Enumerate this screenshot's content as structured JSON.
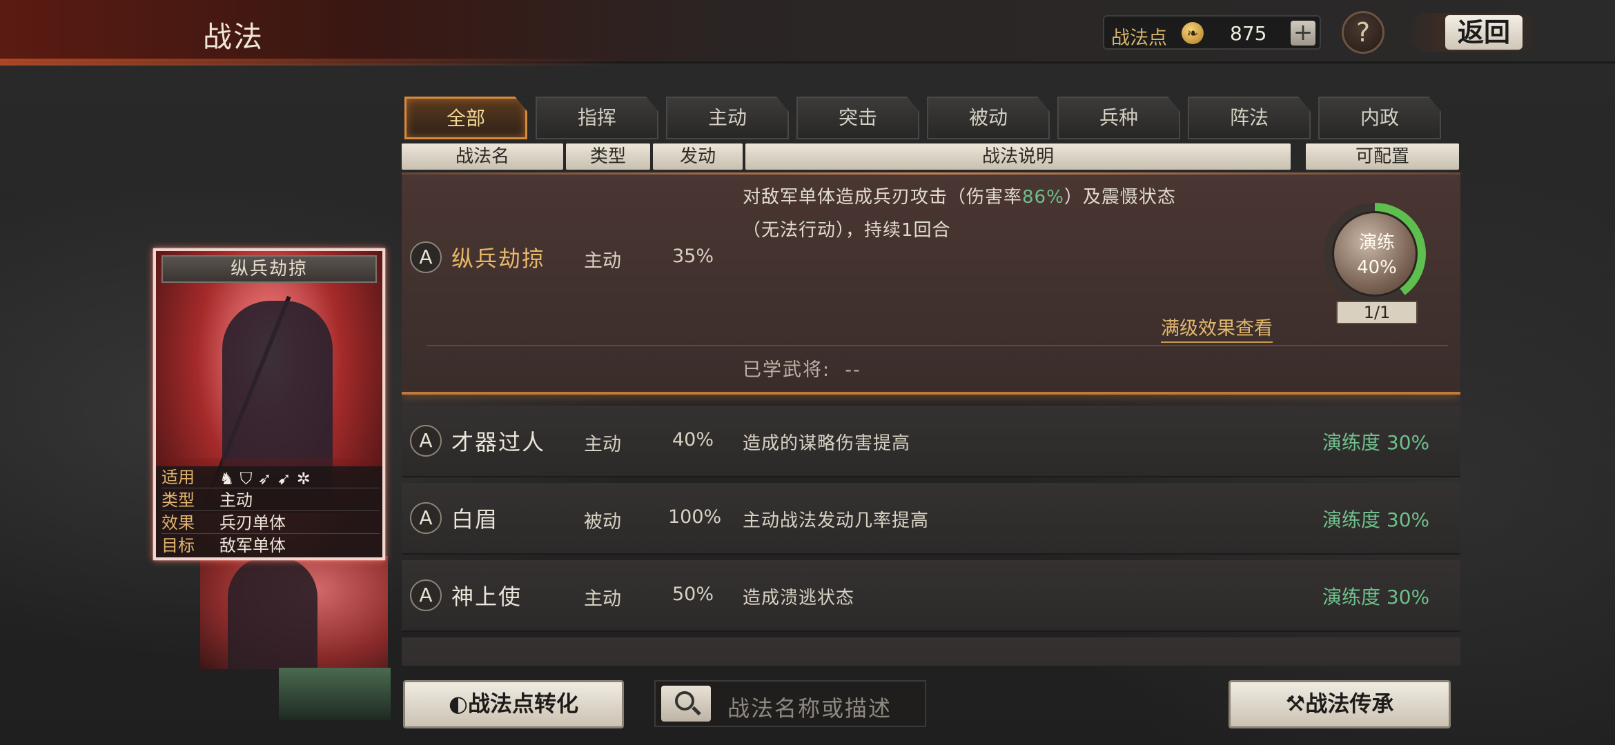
{
  "header": {
    "title": "战法",
    "points_label": "战法点",
    "points_value": "875",
    "add_label": "+",
    "help_label": "?",
    "back_label": "返回"
  },
  "tabs": [
    "全部",
    "指挥",
    "主动",
    "突击",
    "被动",
    "兵种",
    "阵法",
    "内政"
  ],
  "active_tab": "全部",
  "columns": {
    "name": "战法名",
    "type": "类型",
    "rate": "发动",
    "desc": "战法说明",
    "config": "可配置"
  },
  "selected": {
    "rank": "A",
    "name": "纵兵劫掠",
    "type": "主动",
    "rate": "35%",
    "desc_line1_a": "对敌军单体造成兵刃攻击（伤害率",
    "desc_line1_hl": "86%",
    "desc_line1_b": "）及震慑状态",
    "desc_line2": "（无法行动），持续1回合",
    "max_level_link": "满级效果查看",
    "learned_label": "已学武将:",
    "learned_value": "--",
    "train_label": "演练",
    "train_pct": "40%",
    "train_progress": 0.4,
    "train_count": "1/1"
  },
  "rows": [
    {
      "rank": "A",
      "name": "才器过人",
      "type": "主动",
      "rate": "40%",
      "desc": "造成的谋略伤害提高",
      "prof": "演练度 30%"
    },
    {
      "rank": "A",
      "name": "白眉",
      "type": "被动",
      "rate": "100%",
      "desc": "主动战法发动几率提高",
      "prof": "演练度 30%"
    },
    {
      "rank": "A",
      "name": "神上使",
      "type": "主动",
      "rate": "50%",
      "desc": "造成溃逃状态",
      "prof": "演练度 30%"
    }
  ],
  "card": {
    "title": "纵兵劫掠",
    "labels": {
      "apply": "适用",
      "type": "类型",
      "effect": "效果",
      "target": "目标"
    },
    "type": "主动",
    "effect": "兵刃单体",
    "target": "敌军单体",
    "unit_icons": [
      "cavalry-icon",
      "shield-icon",
      "bow-icon",
      "spear-icon",
      "wheel-icon"
    ]
  },
  "bottom": {
    "convert_label": "战法点转化",
    "search_placeholder": "战法名称或描述",
    "inherit_label": "战法传承"
  }
}
